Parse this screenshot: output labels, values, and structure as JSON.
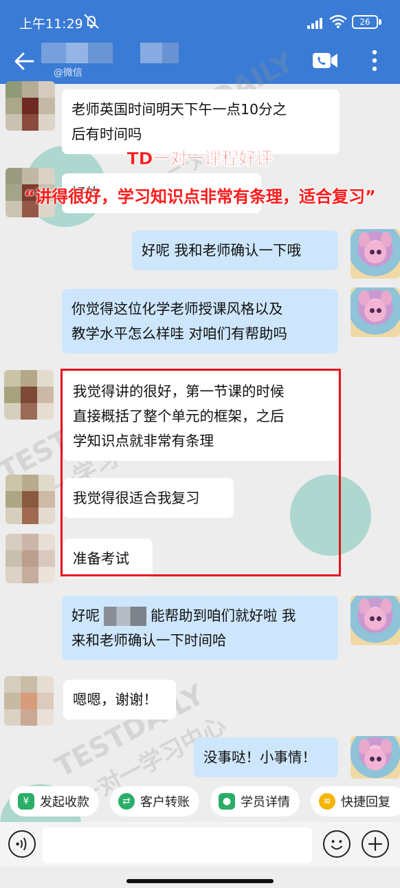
{
  "status_bar": {
    "time": "上午11:29",
    "battery": "26"
  },
  "header": {
    "contact_suffix": "@微信"
  },
  "promo": {
    "title": "TD一对一课程好评",
    "quote": "“讲得很好，学习知识点非常有条理，适合复习”"
  },
  "watermark": {
    "brand": "TESTDAILY",
    "slogan": "一对一学习中心",
    "badge": "TestDaily"
  },
  "messages": [
    {
      "side": "in",
      "text_lines": [
        "老师英国时间明天下午一点10分之",
        "后有时间吗"
      ]
    },
    {
      "side": "in",
      "text_lines": [
        "好的"
      ]
    },
    {
      "side": "out",
      "text_lines": [
        "好呢 我和老师确认一下哦"
      ]
    },
    {
      "side": "out",
      "text_lines": [
        "你觉得这位化学老师授课风格以及",
        "教学水平怎么样哇 对咱们有帮助吗"
      ]
    },
    {
      "side": "in",
      "text_lines": [
        "我觉得讲的很好，第一节课的时候",
        "直接概括了整个单元的框架，之后",
        "学知识点就非常有条理"
      ]
    },
    {
      "side": "in",
      "text_lines": [
        "我觉得很适合我复习"
      ]
    },
    {
      "side": "in",
      "text_lines": [
        "准备考试"
      ]
    },
    {
      "side": "out",
      "text_prefix": "好呢",
      "text_suffix": "能帮助到咱们就好啦 我",
      "text_line2": "来和老师确认一下时间哈"
    },
    {
      "side": "in",
      "text_lines": [
        "嗯嗯，谢谢！"
      ]
    },
    {
      "side": "out",
      "text_lines": [
        "没事哒！小事情！"
      ]
    }
  ],
  "quick_actions": [
    {
      "label": "发起收款",
      "icon": "yuan-icon",
      "color": "#2aae67"
    },
    {
      "label": "客户转账",
      "icon": "transfer-icon",
      "color": "#2aae67"
    },
    {
      "label": "学员详情",
      "icon": "user-icon",
      "color": "#2aae67"
    },
    {
      "label": "快捷回复",
      "icon": "quick-reply-icon",
      "color": "#f4b400"
    }
  ]
}
